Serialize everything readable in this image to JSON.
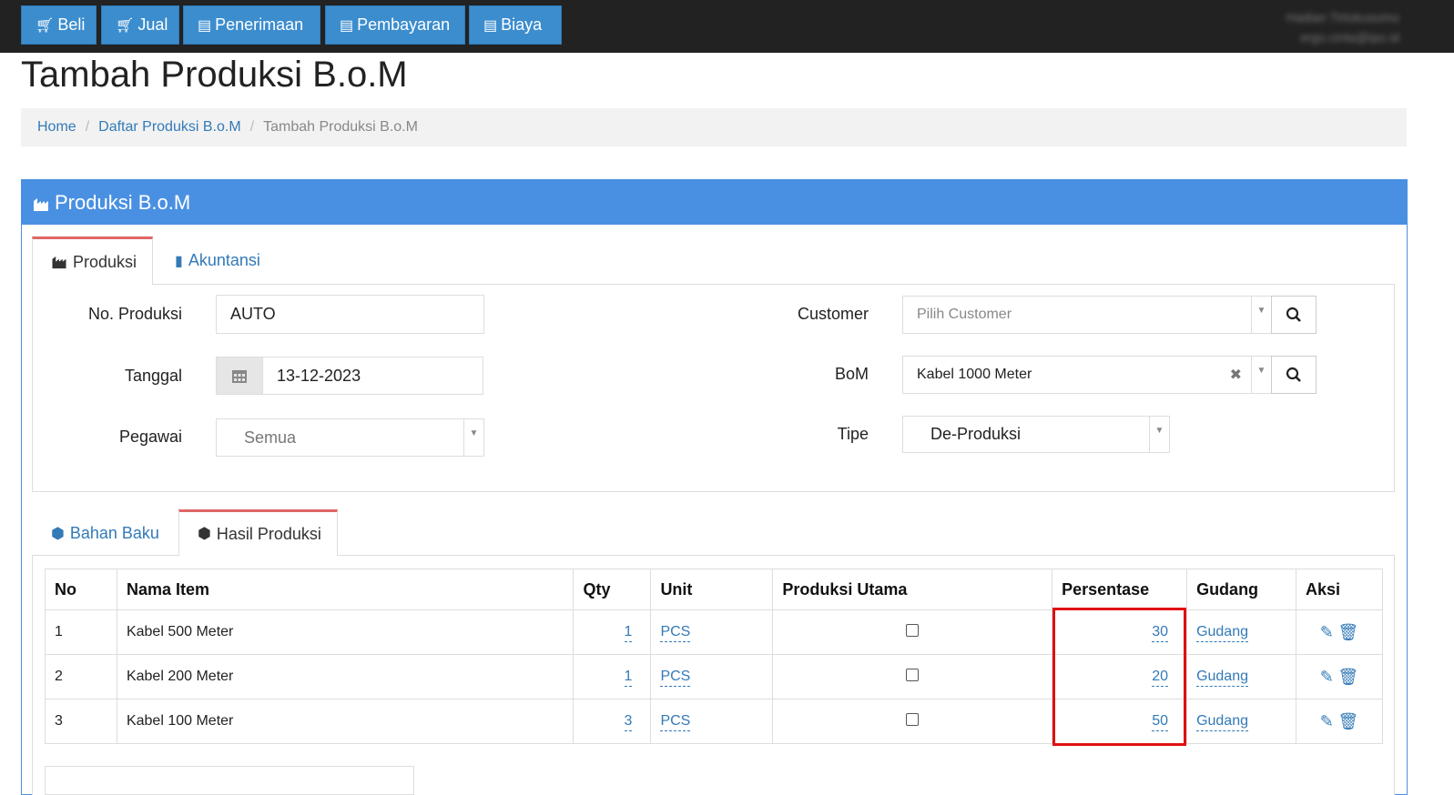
{
  "topnav": {
    "buttons": [
      {
        "label": "Beli",
        "icon": "cart-icon"
      },
      {
        "label": "Jual",
        "icon": "cart-icon"
      },
      {
        "label": "Penerimaan",
        "icon": "money-icon"
      },
      {
        "label": "Pembayaran",
        "icon": "money-icon"
      },
      {
        "label": "Biaya",
        "icon": "money-icon"
      }
    ],
    "user_line1": "Hadian Tirtokusumo",
    "user_line2": "ergo.cinta@ipo.id"
  },
  "page": {
    "title": "Tambah Produksi B.o.M"
  },
  "breadcrumb": {
    "home": "Home",
    "list": "Daftar Produksi B.o.M",
    "current": "Tambah Produksi B.o.M"
  },
  "panel": {
    "title": "Produksi B.o.M"
  },
  "tabs": {
    "produksi": "Produksi",
    "akuntansi": "Akuntansi"
  },
  "form": {
    "no_produksi_label": "No. Produksi",
    "no_produksi_value": "AUTO",
    "tanggal_label": "Tanggal",
    "tanggal_value": "13-12-2023",
    "pegawai_label": "Pegawai",
    "pegawai_value": "Semua",
    "customer_label": "Customer",
    "customer_placeholder": "Pilih Customer",
    "bom_label": "BoM",
    "bom_value": "Kabel 1000 Meter",
    "tipe_label": "Tipe",
    "tipe_value": "De-Produksi"
  },
  "subtabs": {
    "bahan_baku": "Bahan Baku",
    "hasil_produksi": "Hasil Produksi"
  },
  "table": {
    "headers": [
      "No",
      "Nama Item",
      "Qty",
      "Unit",
      "Produksi Utama",
      "Persentase",
      "Gudang",
      "Aksi"
    ],
    "rows": [
      {
        "no": "1",
        "item": "Kabel 500 Meter",
        "qty": "1",
        "unit": "PCS",
        "utama": false,
        "persen": "30",
        "gudang": "Gudang"
      },
      {
        "no": "2",
        "item": "Kabel 200 Meter",
        "qty": "1",
        "unit": "PCS",
        "utama": false,
        "persen": "20",
        "gudang": "Gudang"
      },
      {
        "no": "3",
        "item": "Kabel 100 Meter",
        "qty": "3",
        "unit": "PCS",
        "utama": false,
        "persen": "50",
        "gudang": "Gudang"
      }
    ]
  },
  "colors": {
    "primary": "#3c8dce",
    "panel": "#4a90e2",
    "highlight": "#e01010"
  }
}
